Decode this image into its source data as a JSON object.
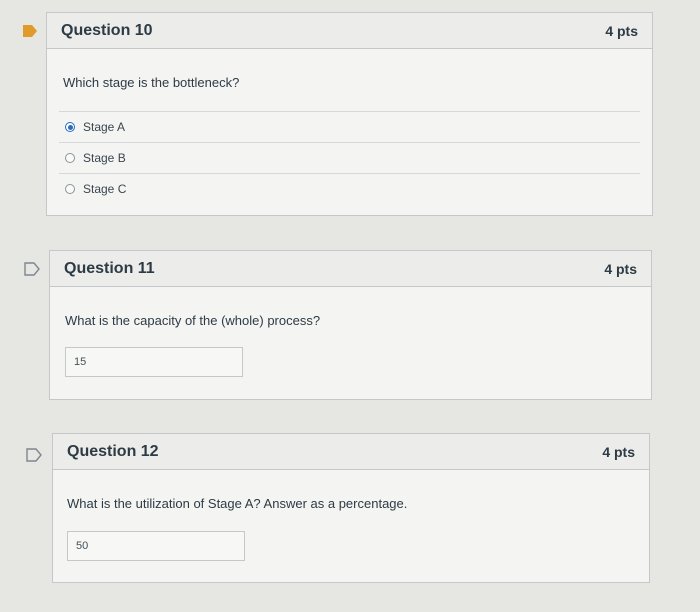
{
  "questions": [
    {
      "title": "Question 10",
      "points": "4 pts",
      "prompt": "Which stage is the bottleneck?",
      "options": [
        {
          "label": "Stage A",
          "selected": true
        },
        {
          "label": "Stage B",
          "selected": false
        },
        {
          "label": "Stage C",
          "selected": false
        }
      ],
      "flag_filled": true,
      "flag_color": "#e09b2a"
    },
    {
      "title": "Question 11",
      "points": "4 pts",
      "prompt": "What is the capacity of the (whole) process?",
      "answer_value": "15",
      "flag_filled": false
    },
    {
      "title": "Question 12",
      "points": "4 pts",
      "prompt": "What is the utilization of Stage A? Answer as a percentage.",
      "answer_value": "50",
      "flag_filled": false
    }
  ]
}
